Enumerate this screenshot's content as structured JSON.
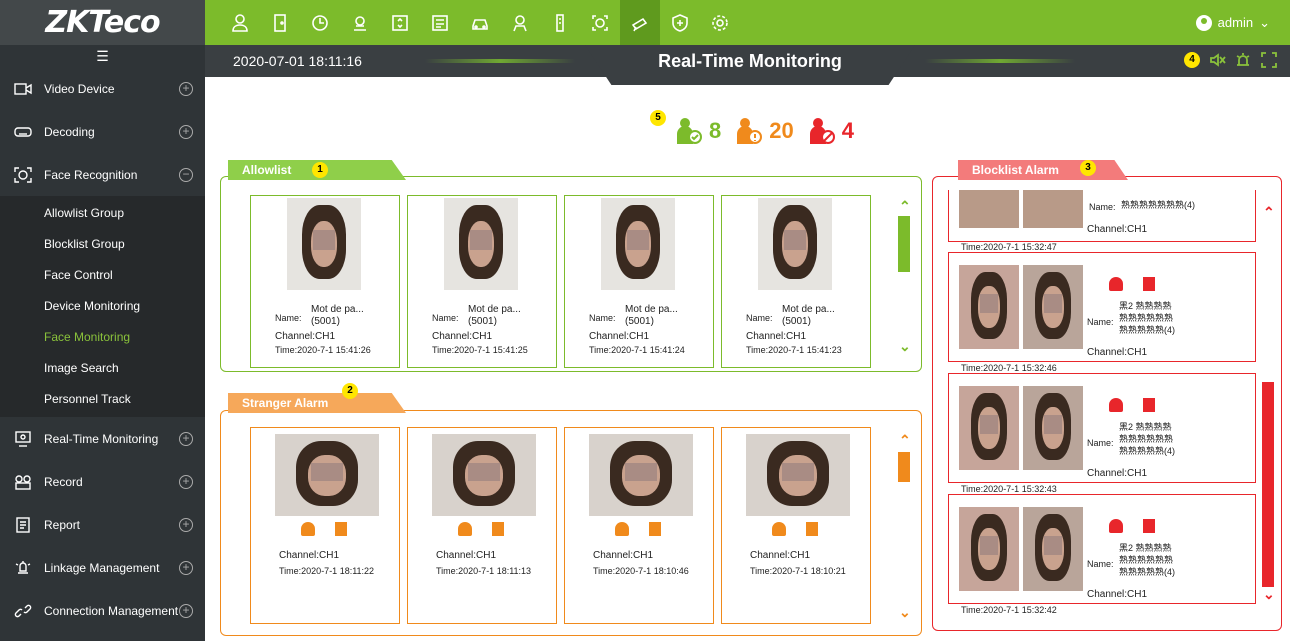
{
  "app": {
    "logo": "ZKTeco",
    "user": "admin",
    "user_caret": "⌄"
  },
  "topnav": [
    "person-icon",
    "door-icon",
    "clock-icon",
    "gear-person-icon",
    "elevator-icon",
    "id-card-icon",
    "car-icon",
    "visitor-icon",
    "pass-icon",
    "face-scan-icon",
    "camera-icon",
    "patrol-icon",
    "settings-icon"
  ],
  "sidebar": {
    "collapse_icon": "☰",
    "items": [
      {
        "label": "Video Device",
        "icon": "video-icon",
        "toggle": "+"
      },
      {
        "label": "Decoding",
        "icon": "decoder-icon",
        "toggle": "+"
      },
      {
        "label": "Face Recognition",
        "icon": "face-icon",
        "toggle": "−"
      }
    ],
    "sub": [
      "Allowlist Group",
      "Blocklist Group",
      "Face Control",
      "Device Monitoring",
      "Face Monitoring",
      "Image Search",
      "Personnel Track"
    ],
    "items2": [
      {
        "label": "Real-Time Monitoring",
        "icon": "monitor-icon",
        "toggle": "+"
      },
      {
        "label": "Record",
        "icon": "record-icon",
        "toggle": "+"
      },
      {
        "label": "Report",
        "icon": "report-icon",
        "toggle": "+"
      },
      {
        "label": "Linkage Management",
        "icon": "linkage-icon",
        "toggle": "+"
      },
      {
        "label": "Connection Management",
        "icon": "link-icon",
        "toggle": "+"
      }
    ]
  },
  "header": {
    "datetime": "2020-07-01 18:11:16",
    "title": "Real-Time Monitoring",
    "badge": "4"
  },
  "stats": {
    "badge": "5",
    "allow": "8",
    "stranger": "20",
    "block": "4"
  },
  "allowlist": {
    "tab": "Allowlist",
    "badge": "1",
    "cards": [
      {
        "name_label": "Name:",
        "name": "Mot de pa...",
        "id": "(5001)",
        "channel": "Channel:CH1",
        "time": "Time:2020-7-1 15:41:26"
      },
      {
        "name_label": "Name:",
        "name": "Mot de pa...",
        "id": "(5001)",
        "channel": "Channel:CH1",
        "time": "Time:2020-7-1 15:41:25"
      },
      {
        "name_label": "Name:",
        "name": "Mot de pa...",
        "id": "(5001)",
        "channel": "Channel:CH1",
        "time": "Time:2020-7-1 15:41:24"
      },
      {
        "name_label": "Name:",
        "name": "Mot de pa...",
        "id": "(5001)",
        "channel": "Channel:CH1",
        "time": "Time:2020-7-1 15:41:23"
      }
    ]
  },
  "stranger": {
    "tab": "Stranger Alarm",
    "badge": "2",
    "cards": [
      {
        "channel": "Channel:CH1",
        "time": "Time:2020-7-1 18:11:22"
      },
      {
        "channel": "Channel:CH1",
        "time": "Time:2020-7-1 18:11:13"
      },
      {
        "channel": "Channel:CH1",
        "time": "Time:2020-7-1 18:10:46"
      },
      {
        "channel": "Channel:CH1",
        "time": "Time:2020-7-1 18:10:21"
      }
    ]
  },
  "blocklist": {
    "tab": "Blocklist Alarm",
    "badge": "3",
    "top_partial": {
      "name_label": "Name:",
      "name": "熟熟熟熟熟熟熟(4)",
      "channel": "Channel:CH1",
      "time": "Time:2020-7-1 15:32:47"
    },
    "cards": [
      {
        "name_label": "Name:",
        "line1": "黑2 熟熟熟熟",
        "line2": "熟熟熟熟熟熟",
        "line3": "熟熟熟熟熟(4)",
        "channel": "Channel:CH1",
        "time": "Time:2020-7-1 15:32:46"
      },
      {
        "name_label": "Name:",
        "line1": "黑2 熟熟熟熟",
        "line2": "熟熟熟熟熟熟",
        "line3": "熟熟熟熟熟(4)",
        "channel": "Channel:CH1",
        "time": "Time:2020-7-1 15:32:43"
      },
      {
        "name_label": "Name:",
        "line1": "黑2 熟熟熟熟",
        "line2": "熟熟熟熟熟熟",
        "line3": "熟熟熟熟熟(4)",
        "channel": "Channel:CH1",
        "time": "Time:2020-7-1 15:32:42"
      }
    ]
  },
  "colors": {
    "green": "#7cbb2b",
    "orange": "#f08a1c",
    "red": "#e8262b",
    "sidebar": "#2f3437"
  }
}
